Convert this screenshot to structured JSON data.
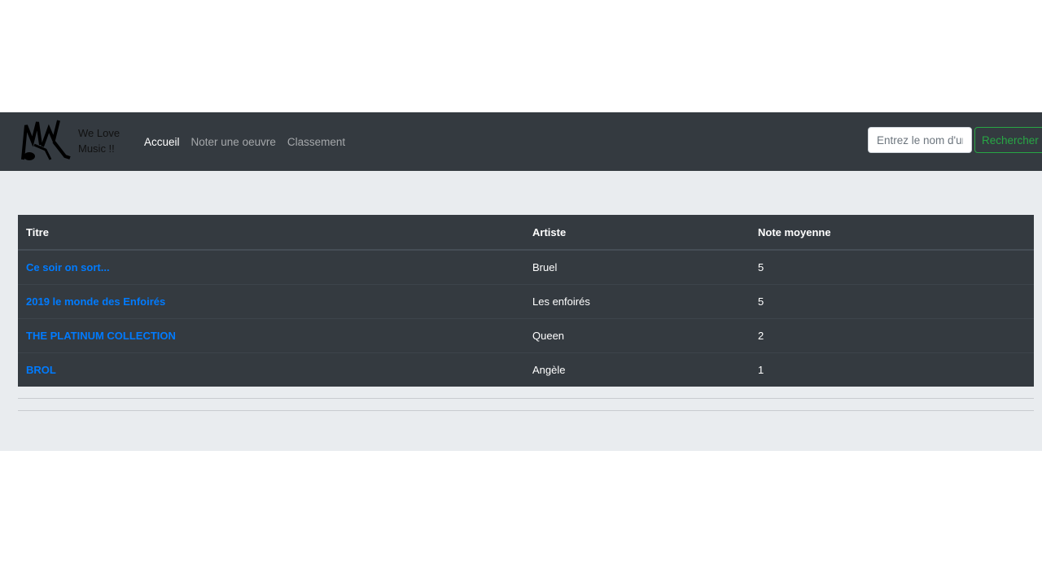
{
  "brand": {
    "line1": "We Love",
    "line2": "Music !!",
    "logo_icon": "music-logo-icon"
  },
  "nav": {
    "items": [
      {
        "label": "Accueil",
        "active": true
      },
      {
        "label": "Noter une oeuvre",
        "active": false
      },
      {
        "label": "Classement",
        "active": false
      }
    ]
  },
  "search": {
    "placeholder": "Entrez le nom d'un",
    "button_label": "Rechercher"
  },
  "table": {
    "headers": [
      "Titre",
      "Artiste",
      "Note moyenne"
    ],
    "rows": [
      {
        "title": "Ce soir on sort...",
        "artist": "Bruel",
        "rating": "5"
      },
      {
        "title": "2019 le monde des Enfoirés",
        "artist": "Les enfoirés",
        "rating": "5"
      },
      {
        "title": "THE PLATINUM COLLECTION",
        "artist": "Queen",
        "rating": "2"
      },
      {
        "title": "BROL",
        "artist": "Angèle",
        "rating": "1"
      }
    ]
  },
  "colors": {
    "navbar": "#343a40",
    "link": "#007bff",
    "success": "#28a745",
    "background": "#e9ecef"
  }
}
